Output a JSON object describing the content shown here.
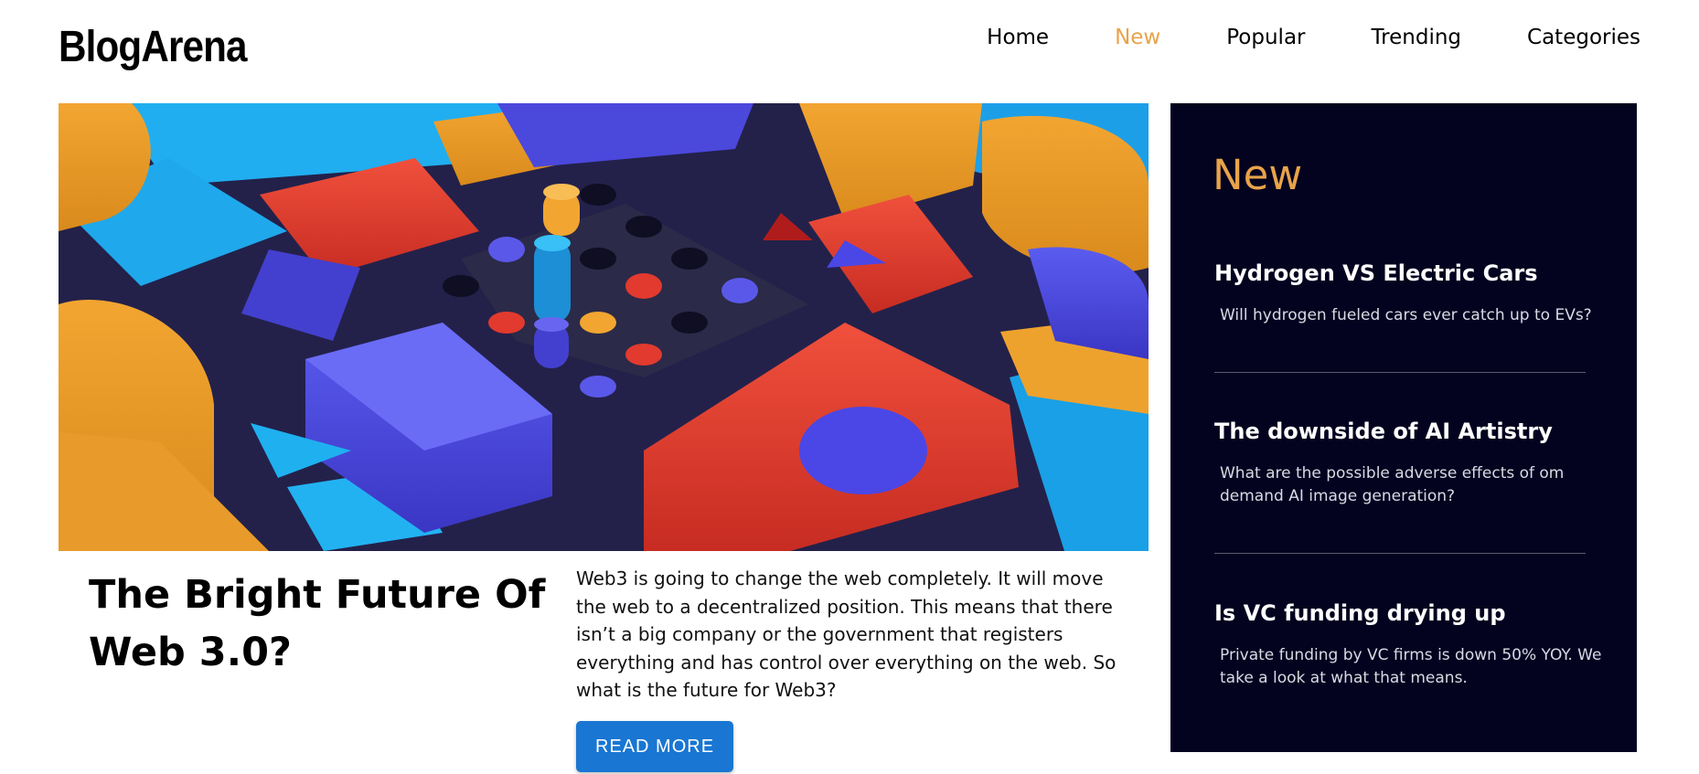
{
  "header": {
    "logo": "BlogArena",
    "nav": [
      {
        "label": "Home",
        "active": false
      },
      {
        "label": "New",
        "active": true
      },
      {
        "label": "Popular",
        "active": false
      },
      {
        "label": "Trending",
        "active": false
      },
      {
        "label": "Categories",
        "active": false
      }
    ]
  },
  "article": {
    "title": "The Bright Future Of Web 3.0?",
    "excerpt": "Web3 is going to change the web completely. It will move the web to a decentralized position. This means that there isn’t a big company or the government that registers everything and has control over everything on the web. So what is the future for Web3?",
    "cta_label": "READ MORE"
  },
  "sidebar": {
    "heading": "New",
    "posts": [
      {
        "title": "Hydrogen VS Electric Cars",
        "summary": "Will hydrogen fueled cars ever catch up to EVs?"
      },
      {
        "title": "The downside of AI Artistry",
        "summary": "What are the possible adverse effects of om demand AI image generation?"
      },
      {
        "title": "Is VC funding drying up",
        "summary": "Private funding by VC firms is down 50% YOY. We take a look at what that means."
      }
    ]
  },
  "colors": {
    "accent": "#e8a34a",
    "button": "#1976d2",
    "sidebar_bg": "#03031f"
  }
}
